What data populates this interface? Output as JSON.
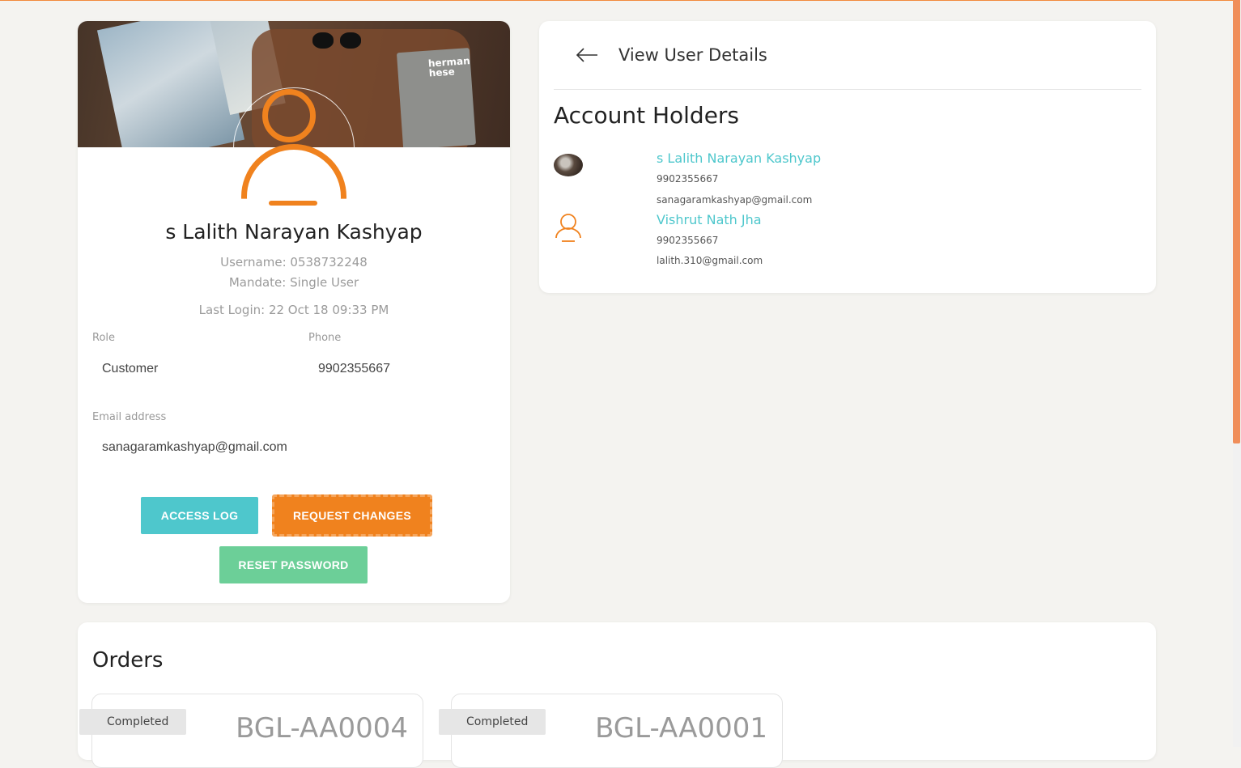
{
  "profile": {
    "name": "s Lalith Narayan Kashyap",
    "username": "Username: 0538732248",
    "mandate": "Mandate: Single User",
    "last_login": "Last Login: 22 Oct 18 09:33 PM",
    "role_label": "Role",
    "role_value": "Customer",
    "phone_label": "Phone",
    "phone_value": "9902355667",
    "email_label": "Email address",
    "email_value": "sanagaramkashyap@gmail.com",
    "cover_book_title": "herman hese",
    "buttons": {
      "access_log": "ACCESS LOG",
      "request_changes": "REQUEST CHANGES",
      "reset_password": "RESET PASSWORD"
    }
  },
  "details": {
    "title": "View User Details",
    "section": "Account Holders",
    "holders": [
      {
        "name": "s Lalith Narayan Kashyap",
        "phone": "9902355667",
        "email": "sanagaramkashyap@gmail.com"
      },
      {
        "name": "Vishrut Nath Jha",
        "phone": "9902355667",
        "email": "lalith.310@gmail.com"
      }
    ]
  },
  "orders": {
    "title": "Orders",
    "items": [
      {
        "status": "Completed",
        "id": "BGL-AA0004"
      },
      {
        "status": "Completed",
        "id": "BGL-AA0001"
      }
    ]
  },
  "colors": {
    "accent_orange": "#f0821e",
    "accent_teal": "#4ec7cc",
    "accent_green": "#6ccf98",
    "background": "#f4f3f0"
  }
}
